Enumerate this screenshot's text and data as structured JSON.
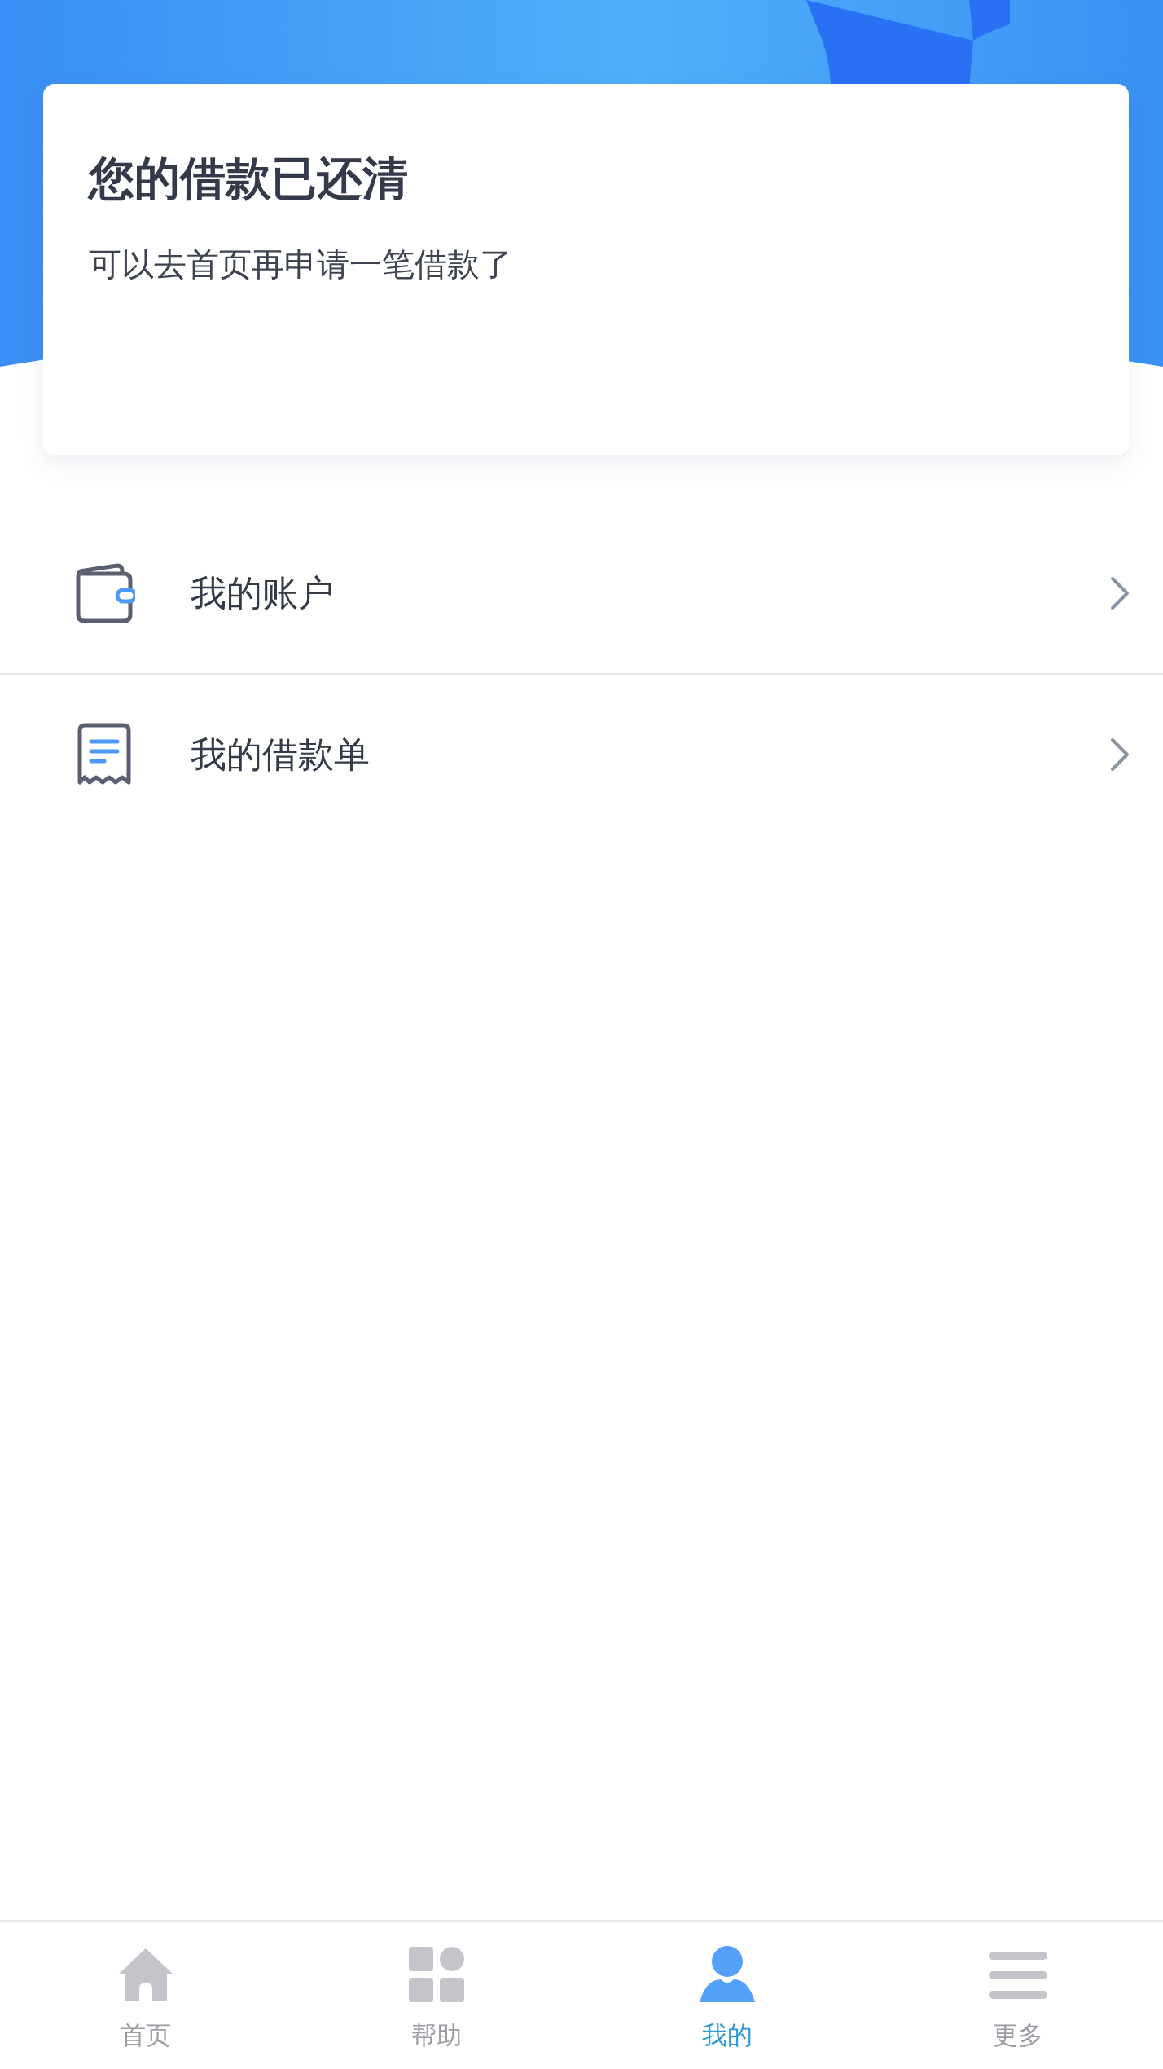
{
  "status_card": {
    "title": "您的借款已还清",
    "subtitle": "可以去首页再申请一笔借款了"
  },
  "menu_items": [
    {
      "kind": "wallet",
      "label": "我的账户"
    },
    {
      "kind": "receipt",
      "label": "我的借款单"
    }
  ],
  "tab_bar": [
    {
      "kind": "home",
      "label": "首页",
      "selected": false
    },
    {
      "kind": "grid",
      "label": "帮助",
      "selected": false
    },
    {
      "kind": "user",
      "label": "我的",
      "selected": true
    },
    {
      "kind": "menu",
      "label": "更多",
      "selected": false
    }
  ]
}
